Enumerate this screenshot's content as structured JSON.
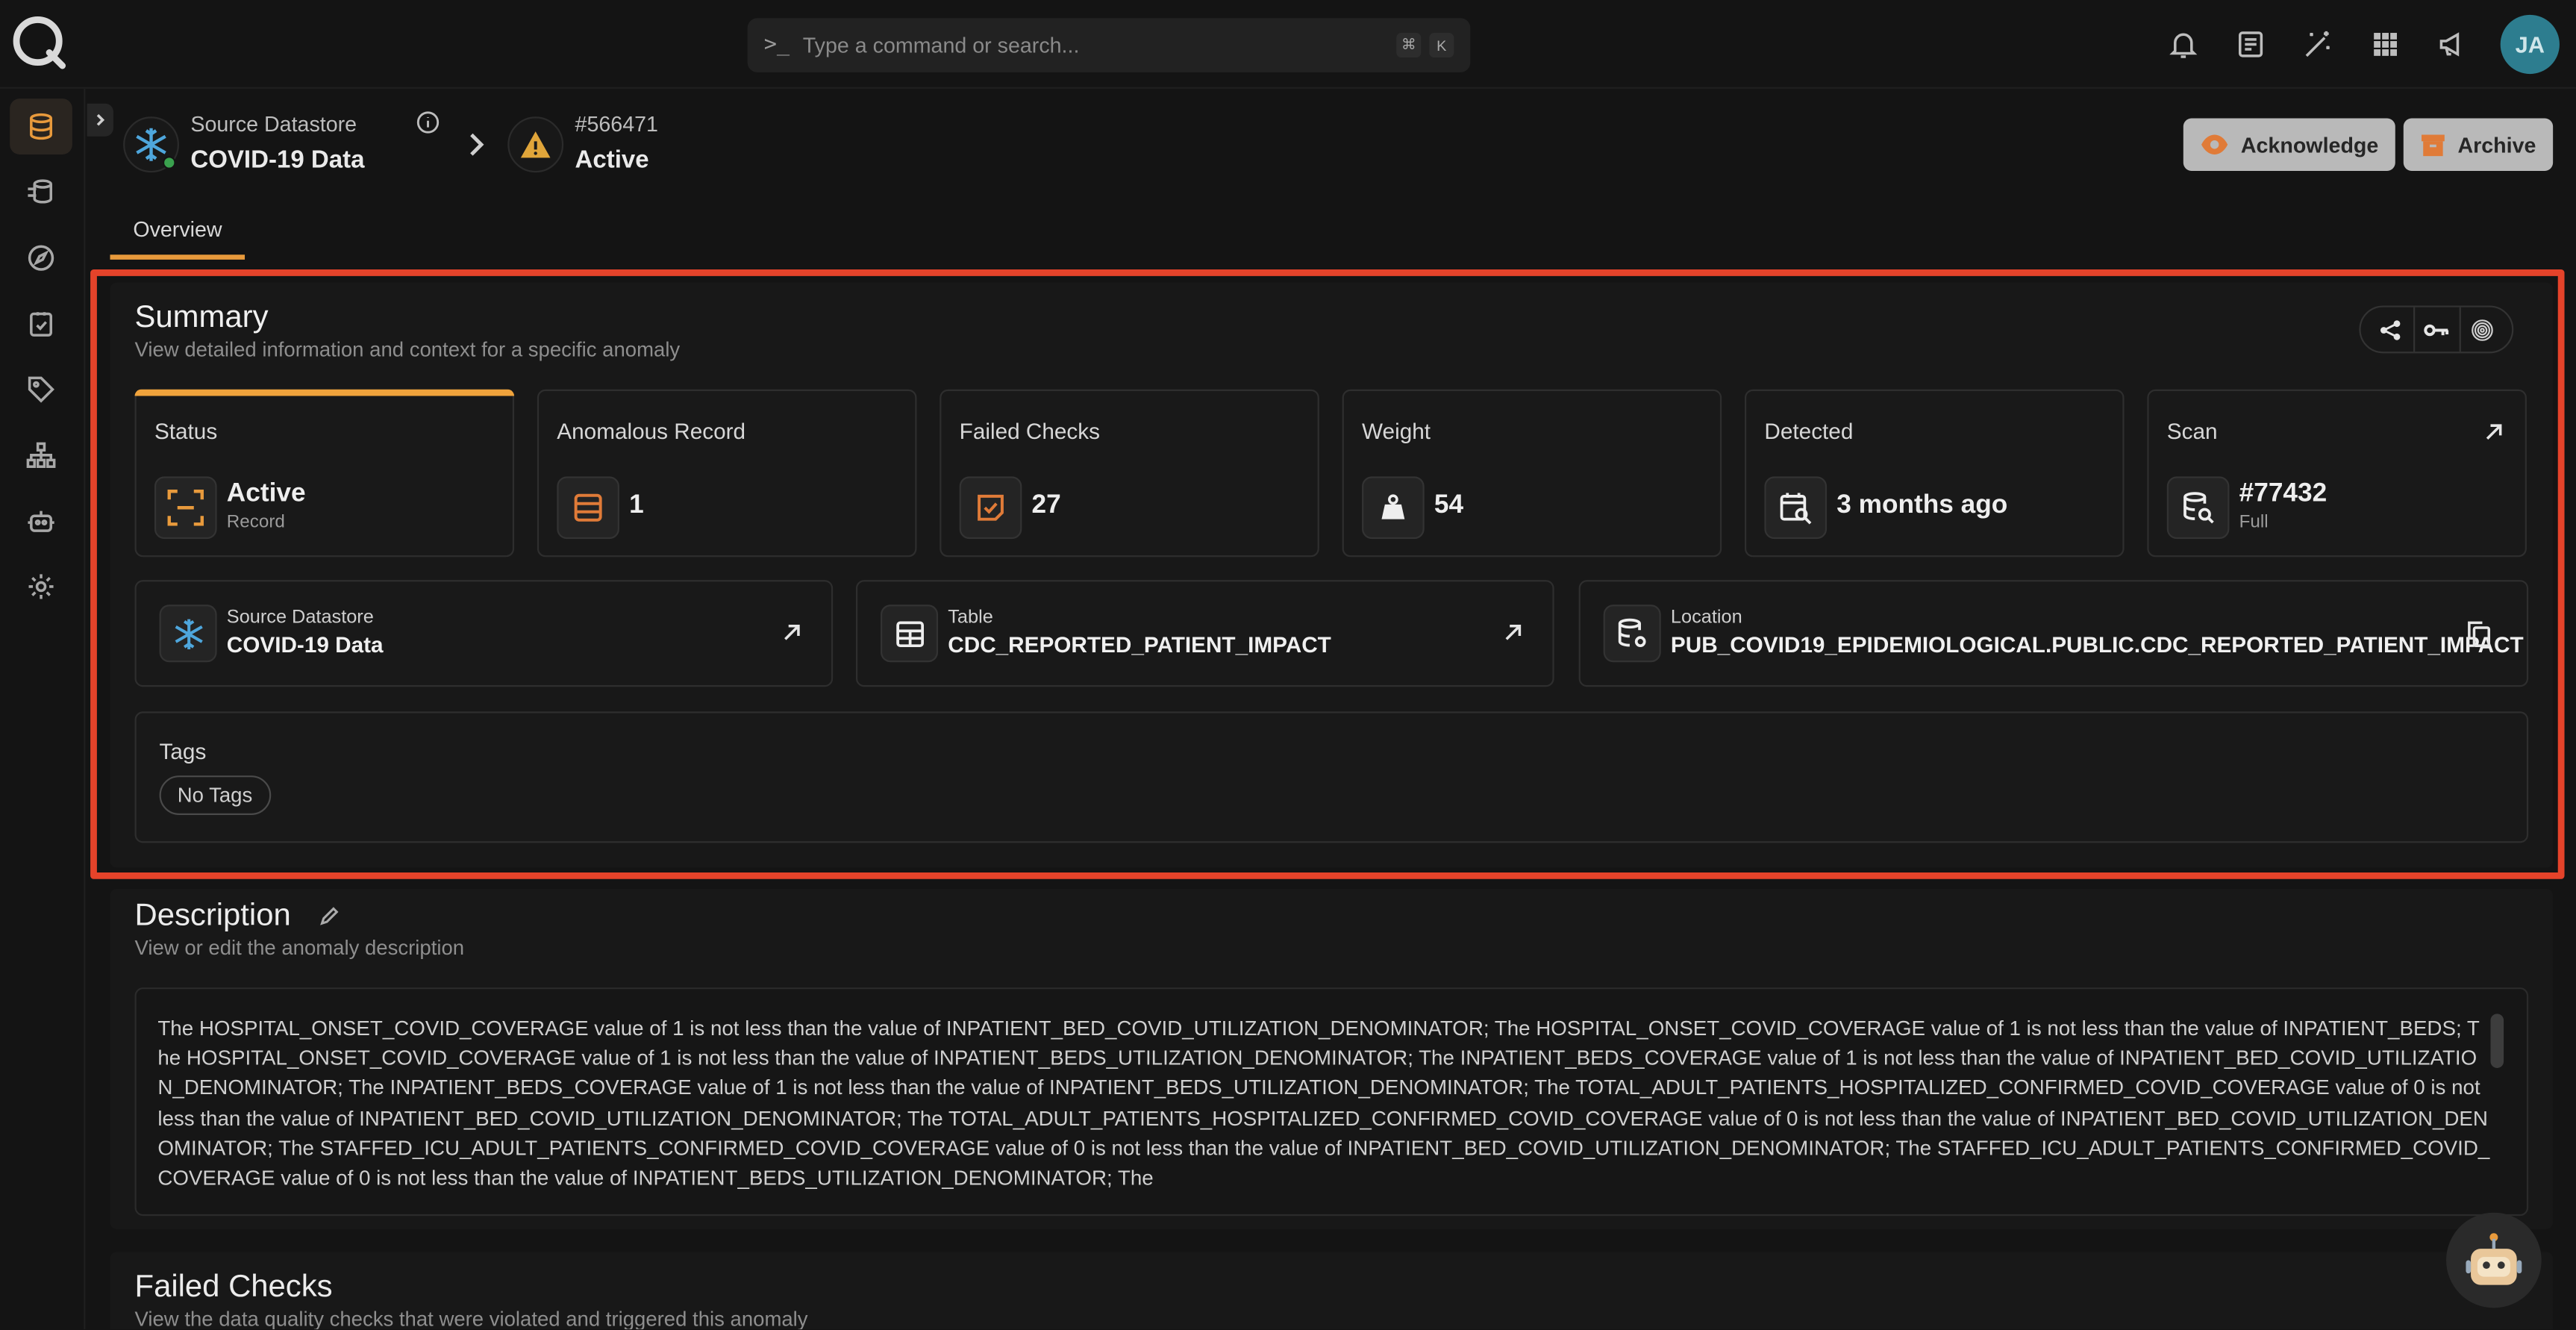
{
  "search": {
    "placeholder": "Type a command or search...",
    "kbd1": "⌘",
    "kbd2": "K"
  },
  "user": {
    "initials": "JA"
  },
  "header": {
    "datastore_label": "Source Datastore",
    "datastore_name": "COVID-19 Data",
    "anomaly_id": "#566471",
    "anomaly_status": "Active",
    "acknowledge_label": "Acknowledge",
    "archive_label": "Archive"
  },
  "tabs": {
    "overview": "Overview"
  },
  "summary": {
    "title": "Summary",
    "subtitle": "View detailed information and context for a specific anomaly",
    "cards": {
      "status": {
        "title": "Status",
        "value": "Active",
        "sub": "Record"
      },
      "anomalous": {
        "title": "Anomalous Record",
        "value": "1"
      },
      "failed": {
        "title": "Failed Checks",
        "value": "27"
      },
      "weight": {
        "title": "Weight",
        "value": "54"
      },
      "detected": {
        "title": "Detected",
        "value": "3 months ago"
      },
      "scan": {
        "title": "Scan",
        "value": "#77432",
        "sub": "Full"
      }
    },
    "source": {
      "label": "Source Datastore",
      "value": "COVID-19 Data"
    },
    "table": {
      "label": "Table",
      "value": "CDC_REPORTED_PATIENT_IMPACT"
    },
    "location": {
      "label": "Location",
      "value": "PUB_COVID19_EPIDEMIOLOGICAL.PUBLIC.CDC_REPORTED_PATIENT_IMPACT"
    },
    "tags": {
      "title": "Tags",
      "empty": "No Tags"
    }
  },
  "description": {
    "title": "Description",
    "subtitle": "View or edit the anomaly description",
    "text": "The HOSPITAL_ONSET_COVID_COVERAGE value of 1 is not less than the value of INPATIENT_BED_COVID_UTILIZATION_DENOMINATOR; The HOSPITAL_ONSET_COVID_COVERAGE value of 1 is not less than the value of INPATIENT_BEDS; The HOSPITAL_ONSET_COVID_COVERAGE value of 1 is not less than the value of INPATIENT_BEDS_UTILIZATION_DENOMINATOR; The INPATIENT_BEDS_COVERAGE value of 1 is not less than the value of INPATIENT_BED_COVID_UTILIZATION_DENOMINATOR; The INPATIENT_BEDS_COVERAGE value of 1 is not less than the value of INPATIENT_BEDS_UTILIZATION_DENOMINATOR; The TOTAL_ADULT_PATIENTS_HOSPITALIZED_CONFIRMED_COVID_COVERAGE value of 0 is not less than the value of INPATIENT_BED_COVID_UTILIZATION_DENOMINATOR; The TOTAL_ADULT_PATIENTS_HOSPITALIZED_CONFIRMED_COVID_COVERAGE value of 0 is not less than the value of INPATIENT_BED_COVID_UTILIZATION_DENOMINATOR; The STAFFED_ICU_ADULT_PATIENTS_CONFIRMED_COVID_COVERAGE value of 0 is not less than the value of INPATIENT_BED_COVID_UTILIZATION_DENOMINATOR; The STAFFED_ICU_ADULT_PATIENTS_CONFIRMED_COVID_COVERAGE value of 0 is not less than the value of INPATIENT_BEDS_UTILIZATION_DENOMINATOR; The"
  },
  "failed_checks": {
    "title": "Failed Checks",
    "subtitle": "View the data quality checks that were violated and triggered this anomaly"
  },
  "colors": {
    "accent": "#e89a3c",
    "highlight": "#e5432a",
    "snowflake": "#4ea6dc"
  }
}
